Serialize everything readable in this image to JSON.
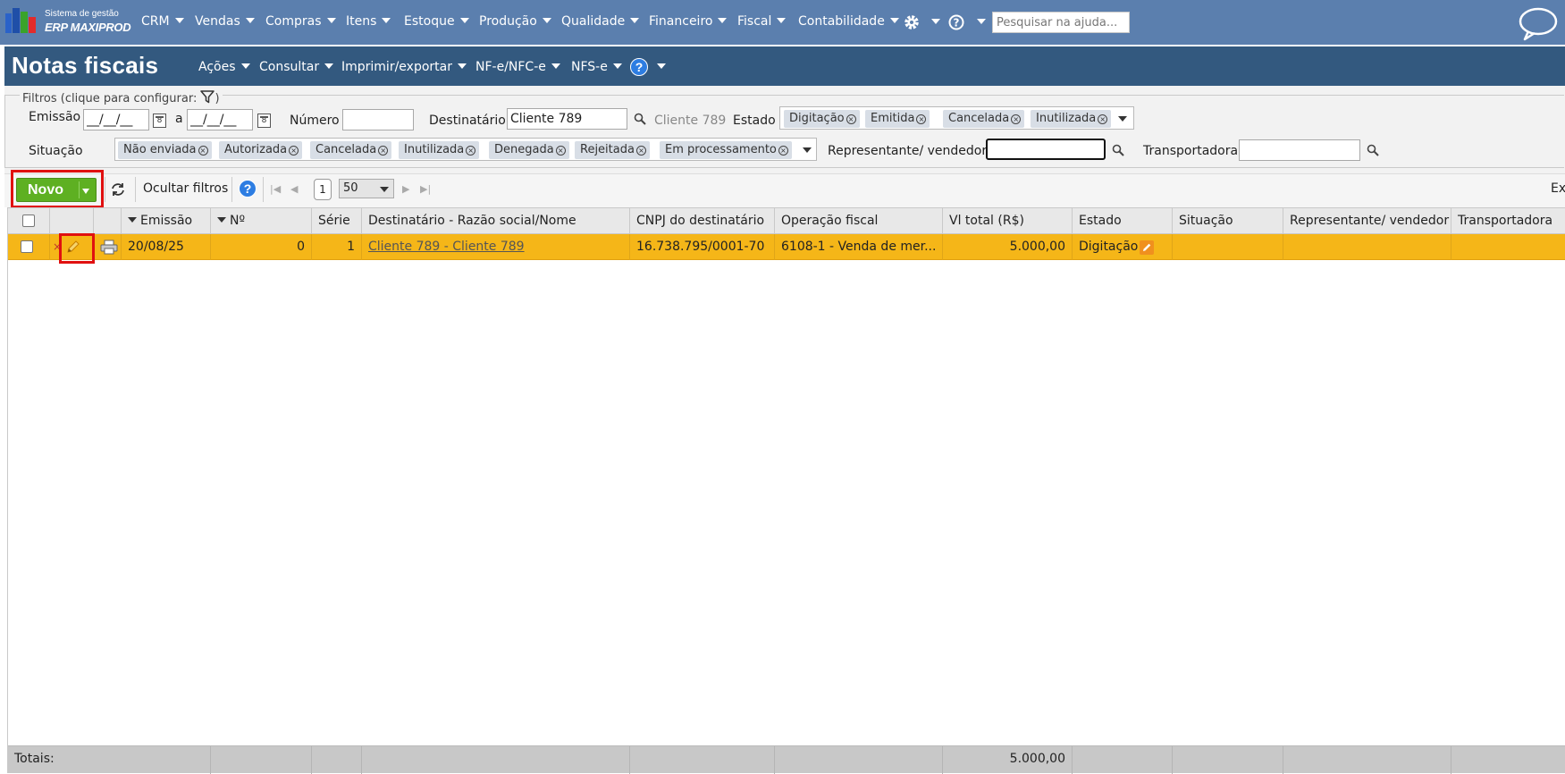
{
  "topnav": {
    "brand_line1": "Sistema de gestão",
    "brand_line2": "ERP MAXIPROD",
    "menus": [
      "CRM",
      "Vendas",
      "Compras",
      "Itens",
      "Estoque",
      "Produção",
      "Qualidade",
      "Financeiro",
      "Fiscal",
      "Contabilidade"
    ],
    "search_placeholder": "Pesquisar na ajuda...",
    "icons": [
      "gear-icon",
      "question-icon",
      "chat-bubble-icon"
    ]
  },
  "titlebar": {
    "title": "Notas fiscais",
    "menus": [
      "Ações",
      "Consultar",
      "Imprimir/exportar",
      "NF-e/NFC-e",
      "NFS-e"
    ]
  },
  "filters": {
    "legend": "Filtros (clique para configurar:",
    "legend_close": ")",
    "emissao_label": "Emissão",
    "emissao_from": "__/__/__",
    "emissao_sep": "a",
    "emissao_to": "__/__/__",
    "numero_label": "Número",
    "numero_value": "",
    "destinatario_label": "Destinatário",
    "destinatario_value": "Cliente 789",
    "destinatario_resolved": "Cliente 789",
    "estado_label": "Estado",
    "estado_tags": [
      "Digitação",
      "Emitida",
      "Cancelada",
      "Inutilizada"
    ],
    "situacao_label": "Situação",
    "situacao_tags": [
      "Não enviada",
      "Autorizada",
      "Cancelada",
      "Inutilizada",
      "Denegada",
      "Rejeitada",
      "Em processamento"
    ],
    "representante_label": "Representante/ vendedor",
    "representante_value": "",
    "transportadora_label": "Transportadora",
    "transportadora_value": ""
  },
  "toolbar": {
    "novo_label": "Novo",
    "hide_filters_label": "Ocultar filtros",
    "page": "1",
    "page_size": "50",
    "right_cut_label": "Ex"
  },
  "grid": {
    "columns": [
      "Emissão",
      "Nº",
      "Série",
      "Destinatário - Razão social/Nome",
      "CNPJ do destinatário",
      "Operação fiscal",
      "Vl total (R$)",
      "Estado",
      "Situação",
      "Representante/ vendedor",
      "Transportadora"
    ],
    "rows": [
      {
        "emissao": "20/08/25",
        "numero": "0",
        "serie": "1",
        "destinatario": "Cliente 789 - Cliente 789",
        "cnpj": "16.738.795/0001-70",
        "operacao": "6108-1 - Venda de mer...",
        "vl_total": "5.000,00",
        "estado": "Digitação",
        "situacao": "",
        "representante": "",
        "transportadora": ""
      }
    ],
    "totals_label": "Totais:",
    "totals_vl_total": "5.000,00"
  },
  "colors": {
    "topnav_bg": "#5b7fae",
    "titlebar_bg": "#33597f",
    "row_highlight": "#f5b618",
    "novo_green": "#5eb022",
    "annotation_red": "#e01010"
  }
}
